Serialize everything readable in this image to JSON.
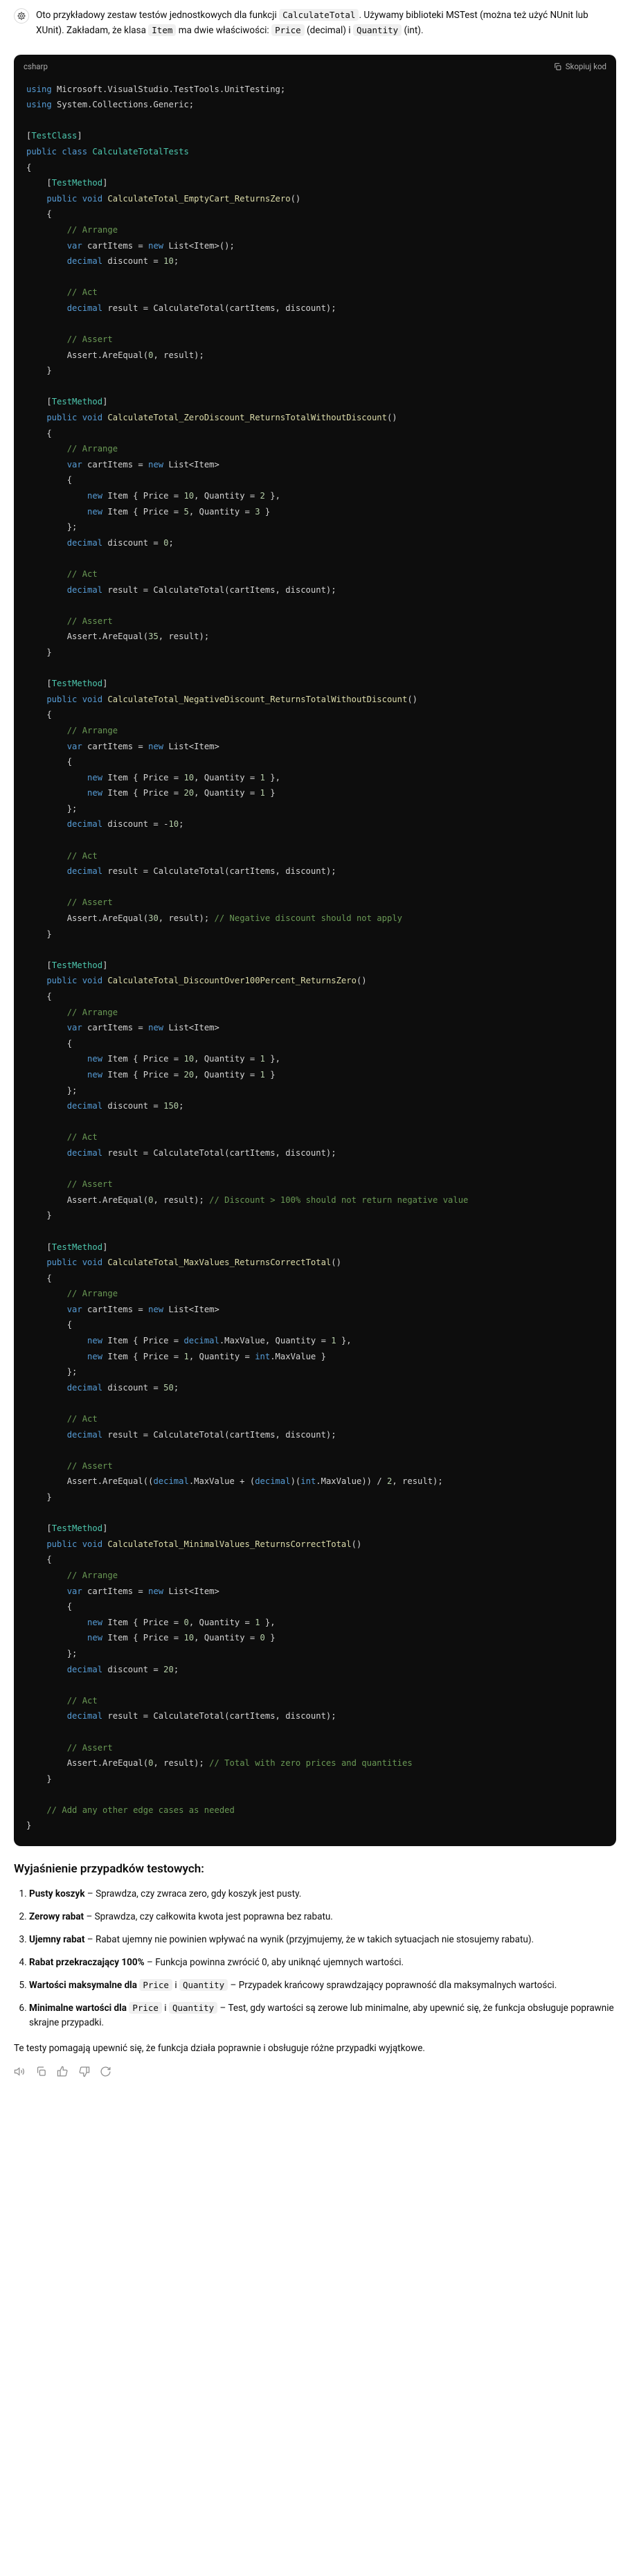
{
  "intro": {
    "p1a": "Oto przykładowy zestaw testów jednostkowych dla funkcji ",
    "code1": "CalculateTotal",
    "p1b": ". Używamy biblioteki MSTest (można też użyć NUnit lub XUnit). Zakładam, że klasa ",
    "code2": "Item",
    "p1c": " ma dwie właściwości: ",
    "code3": "Price",
    "p1d": " (decimal) i ",
    "code4": "Quantity",
    "p1e": " (int)."
  },
  "code": {
    "lang": "csharp",
    "copy": "Skopiuj kod"
  },
  "lines": {
    "l01a": "using",
    "l01b": " Microsoft.VisualStudio.TestTools.UnitTesting;",
    "l02a": "using",
    "l02b": " System.Collections.Generic;",
    "l04a": "[",
    "l04b": "TestClass",
    "l04c": "]",
    "l05a": "public",
    "l05b": " class ",
    "l05c": "CalculateTotalTests",
    "l06": "{",
    "tm_a": "    [",
    "tm_b": "TestMethod",
    "tm_c": "]",
    "m1a": "    public",
    "m1b": " void ",
    "m1c": "CalculateTotal_EmptyCart_ReturnsZero",
    "m1d": "()",
    "ob": "    {",
    "cb": "    }",
    "arr": "        // Arrange",
    "act": "        // Act",
    "ass": "        // Assert",
    "m1_l1a": "        var",
    "m1_l1b": " cartItems = ",
    "m1_l1c": "new",
    "m1_l1d": " List<Item>();",
    "m1_l2a": "        decimal",
    "m1_l2b": " discount = ",
    "m1_l2c": "10",
    "m1_l2d": ";",
    "m1_l3a": "        decimal",
    "m1_l3b": " result = CalculateTotal(cartItems, discount);",
    "m1_l4a": "        Assert.AreEqual(",
    "m1_l4b": "0",
    "m1_l4c": ", result);",
    "m2c": "CalculateTotal_ZeroDiscount_ReturnsTotalWithoutDiscount",
    "m2_l1a": "        var",
    "m2_l1b": " cartItems = ",
    "m2_l1c": "new",
    "m2_l1d": " List<Item>",
    "ob2": "        {",
    "cb2": "        };",
    "m2_i1a": "            new",
    "m2_i1b": " Item { Price = ",
    "m2_i1c": "10",
    "m2_i1d": ", Quantity = ",
    "m2_i1e": "2",
    "m2_i1f": " },",
    "m2_i2a": "            new",
    "m2_i2b": " Item { Price = ",
    "m2_i2c": "5",
    "m2_i2d": ", Quantity = ",
    "m2_i2e": "3",
    "m2_i2f": " }",
    "m2_d": "0",
    "m2_r": "35",
    "m3c": "CalculateTotal_NegativeDiscount_ReturnsTotalWithoutDiscount",
    "m3_i1e": "1",
    "m3_i2c": "20",
    "m3_i2e": "1",
    "m3_da": "        decimal",
    "m3_db": " discount = -",
    "m3_dc": "10",
    "m3_dd": ";",
    "m3_r": "30",
    "m3_cm": " // Negative discount should not apply",
    "m4c": "CalculateTotal_DiscountOver100Percent_ReturnsZero",
    "m4_d": "150",
    "m4_r": "0",
    "m4_cm": " // Discount > 100% should not return negative value",
    "m5c": "CalculateTotal_MaxValues_ReturnsCorrectTotal",
    "m5_i1a": "            new",
    "m5_i1b": " Item { Price = ",
    "m5_i1c": "decimal",
    "m5_i1d": ".MaxValue, Quantity = ",
    "m5_i1e": "1",
    "m5_i1f": " },",
    "m5_i2a": "            new",
    "m5_i2b": " Item { Price = ",
    "m5_i2c": "1",
    "m5_i2d": ", Quantity = ",
    "m5_i2e": "int",
    "m5_i2f": ".MaxValue }",
    "m5_d": "50",
    "m5_ra": "        Assert.AreEqual((",
    "m5_rb": "decimal",
    "m5_rc": ".MaxValue + (",
    "m5_rd": "decimal",
    "m5_re": ")(",
    "m5_rf": "int",
    "m5_rg": ".MaxValue)) / ",
    "m5_rh": "2",
    "m5_ri": ", result);",
    "m6c": "CalculateTotal_MinimalValues_ReturnsCorrectTotal",
    "m6_i1c": "0",
    "m6_i1e": "1",
    "m6_i2c": "10",
    "m6_i2e": "0",
    "m6_d": "20",
    "m6_r": "0",
    "m6_cm": " // Total with zero prices and quantities",
    "add": "    // Add any other edge cases as needed",
    "close": "}"
  },
  "explain": {
    "title": "Wyjaśnienie przypadków testowych:",
    "items": [
      {
        "b": "Pusty koszyk",
        "t": " – Sprawdza, czy zwraca zero, gdy koszyk jest pusty."
      },
      {
        "b": "Zerowy rabat",
        "t": " – Sprawdza, czy całkowita kwota jest poprawna bez rabatu."
      },
      {
        "b": "Ujemny rabat",
        "t": " – Rabat ujemny nie powinien wpływać na wynik (przyjmujemy, że w takich sytuacjach nie stosujemy rabatu)."
      },
      {
        "b": "Rabat przekraczający 100%",
        "t": " – Funkcja powinna zwrócić 0, aby uniknąć ujemnych wartości."
      },
      {
        "b": "Wartości maksymalne dla ",
        "c1": "Price",
        "mid": " i ",
        "c2": "Quantity",
        "t2": " – Przypadek krańcowy sprawdzający poprawność dla maksymalnych wartości."
      },
      {
        "b": "Minimalne wartości dla ",
        "c1": "Price",
        "mid": " i ",
        "c2": "Quantity",
        "t2": " – Test, gdy wartości są zerowe lub minimalne, aby upewnić się, że funkcja obsługuje poprawnie skrajne przypadki."
      }
    ],
    "footer": "Te testy pomagają upewnić się, że funkcja działa poprawnie i obsługuje różne przypadki wyjątkowe."
  }
}
